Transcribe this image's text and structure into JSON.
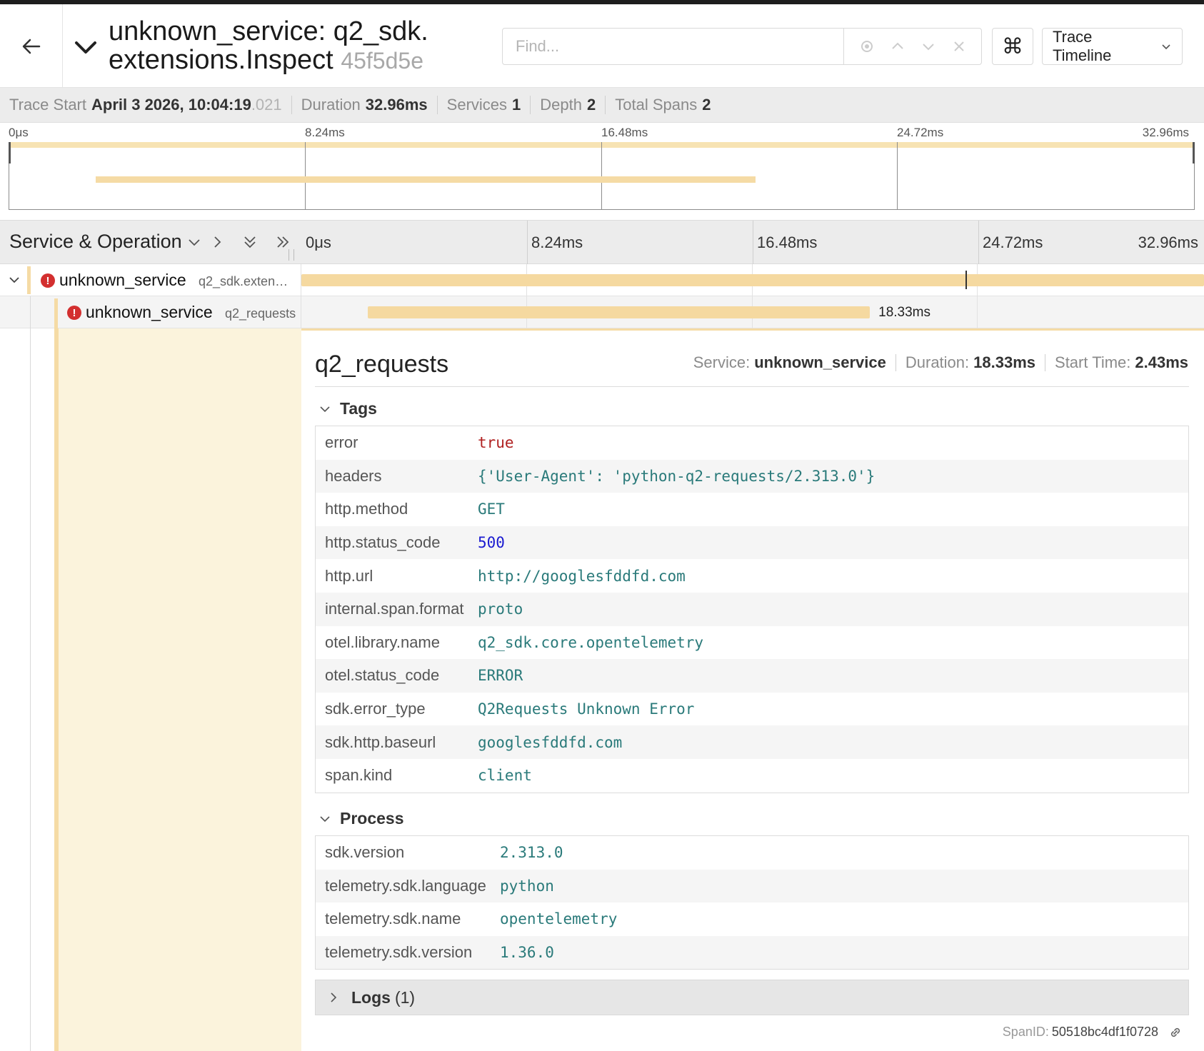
{
  "header": {
    "title_line1": "unknown_service: q2_sdk.",
    "title_line2": "extensions.Inspect",
    "trace_id": "45f5d5e",
    "find_placeholder": "Find...",
    "cmd_symbol": "⌘",
    "view_label": "Trace Timeline"
  },
  "summary": {
    "trace_start_label": "Trace Start",
    "trace_start_value": "April 3 2026, 10:04:19",
    "trace_start_ms": ".021",
    "duration_label": "Duration",
    "duration_value": "32.96ms",
    "services_label": "Services",
    "services_value": "1",
    "depth_label": "Depth",
    "depth_value": "2",
    "total_spans_label": "Total Spans",
    "total_spans_value": "2"
  },
  "timeline": {
    "ticks": [
      "0μs",
      "8.24ms",
      "16.48ms",
      "24.72ms",
      "32.96ms"
    ],
    "column_title": "Service & Operation"
  },
  "spans": [
    {
      "service": "unknown_service",
      "operation": "q2_sdk.exten…",
      "start_ms": 0,
      "duration_ms": 32.96,
      "error": true
    },
    {
      "service": "unknown_service",
      "operation": "q2_requests",
      "start_ms": 2.43,
      "duration_ms": 18.33,
      "duration_label": "18.33ms",
      "error": true
    }
  ],
  "detail": {
    "title": "q2_requests",
    "service_label": "Service:",
    "service_value": "unknown_service",
    "duration_label": "Duration:",
    "duration_value": "18.33ms",
    "start_label": "Start Time:",
    "start_value": "2.43ms",
    "tags_label": "Tags",
    "tags": [
      {
        "key": "error",
        "value": "true",
        "style": "red"
      },
      {
        "key": "headers",
        "value": "{'User-Agent': 'python-q2-requests/2.313.0'}",
        "style": ""
      },
      {
        "key": "http.method",
        "value": "GET",
        "style": ""
      },
      {
        "key": "http.status_code",
        "value": "500",
        "style": "blue"
      },
      {
        "key": "http.url",
        "value": "http://googlesfddfd.com",
        "style": ""
      },
      {
        "key": "internal.span.format",
        "value": "proto",
        "style": ""
      },
      {
        "key": "otel.library.name",
        "value": "q2_sdk.core.opentelemetry",
        "style": ""
      },
      {
        "key": "otel.status_code",
        "value": "ERROR",
        "style": ""
      },
      {
        "key": "sdk.error_type",
        "value": "Q2Requests Unknown Error",
        "style": ""
      },
      {
        "key": "sdk.http.baseurl",
        "value": "googlesfddfd.com",
        "style": ""
      },
      {
        "key": "span.kind",
        "value": "client",
        "style": ""
      }
    ],
    "process_label": "Process",
    "process": [
      {
        "key": "sdk.version",
        "value": "2.313.0"
      },
      {
        "key": "telemetry.sdk.language",
        "value": "python"
      },
      {
        "key": "telemetry.sdk.name",
        "value": "opentelemetry"
      },
      {
        "key": "telemetry.sdk.version",
        "value": "1.36.0"
      }
    ],
    "logs_label": "Logs",
    "logs_count": "(1)",
    "span_id_label": "SpanID:",
    "span_id_value": "50518bc4df1f0728"
  },
  "colors": {
    "span_bar": "#f5d9a0",
    "error_icon": "#d32f2f",
    "tag_value": "#2a7a7a"
  }
}
